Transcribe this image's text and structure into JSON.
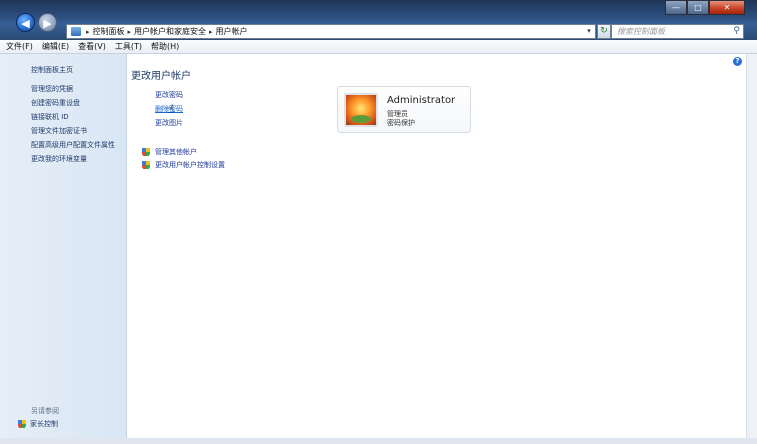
{
  "address": {
    "crumbs": [
      "控制面板",
      "用户帐户和家庭安全",
      "用户帐户"
    ]
  },
  "search": {
    "placeholder": "搜索控制面板"
  },
  "menu": [
    "文件(F)",
    "编辑(E)",
    "查看(V)",
    "工具(T)",
    "帮助(H)"
  ],
  "sidebar": {
    "home": "控制面板主页",
    "links": [
      "管理您的凭据",
      "创建密码重设盘",
      "链接联机 ID",
      "管理文件加密证书",
      "配置高级用户配置文件属性",
      "更改我的环境变量"
    ],
    "see_also": "另请参阅",
    "family": "家长控制"
  },
  "main": {
    "title": "更改用户帐户",
    "tasks": [
      "更改密码",
      "删除密码",
      "更改图片"
    ],
    "other_links": [
      "管理其他帐户",
      "更改用户帐户控制设置"
    ]
  },
  "account": {
    "name": "Administrator",
    "role": "管理员",
    "status": "密码保护"
  },
  "window": {
    "minimize": "—",
    "maximize": "□",
    "close": "✕"
  }
}
